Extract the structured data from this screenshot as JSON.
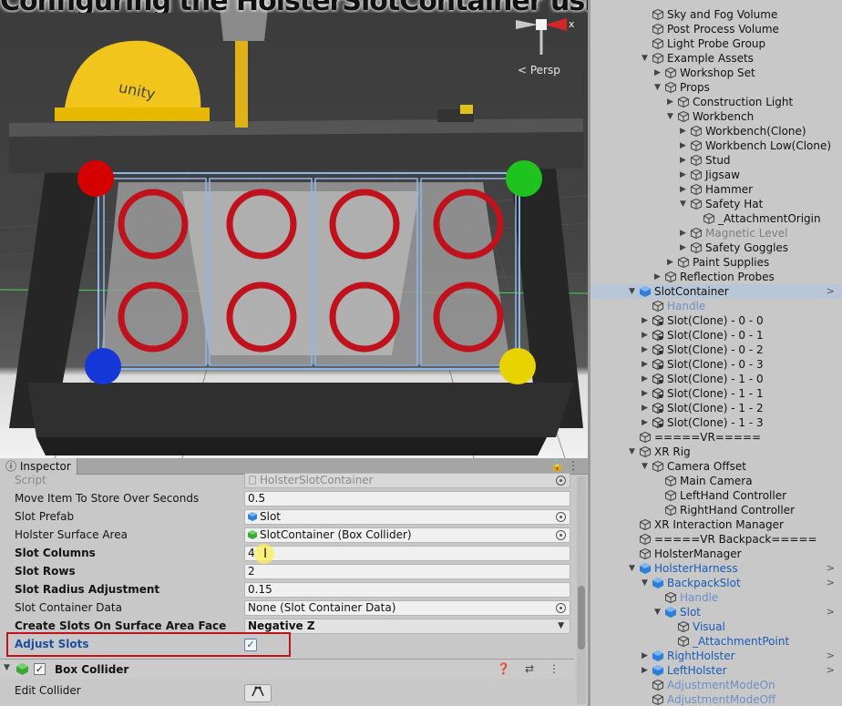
{
  "scene": {
    "overlay_title": "Configuring the HolsterSlotContainer using the Scene",
    "persp_label": "< Persp",
    "gizmo_axis_label": "x",
    "colors": {
      "slot_ring": "#c0121c",
      "corner_red": "#d40000",
      "corner_green": "#1ec31e",
      "corner_blue": "#1638d8",
      "corner_yellow": "#e8d200",
      "helmet": "#f2c51d"
    }
  },
  "hierarchy": {
    "items": [
      {
        "label": "Sky and Fog Volume",
        "depth": 1,
        "arrow": "",
        "icon": "cube-outline-icon"
      },
      {
        "label": "Post Process Volume",
        "depth": 1,
        "arrow": "",
        "icon": "cube-outline-icon"
      },
      {
        "label": "Light Probe Group",
        "depth": 1,
        "arrow": "",
        "icon": "cube-outline-icon"
      },
      {
        "label": "Example Assets",
        "depth": 1,
        "arrow": "▼",
        "icon": "cube-outline-icon"
      },
      {
        "label": "Workshop Set",
        "depth": 2,
        "arrow": "▶",
        "icon": "cube-outline-icon"
      },
      {
        "label": "Props",
        "depth": 2,
        "arrow": "▼",
        "icon": "cube-outline-icon"
      },
      {
        "label": "Construction Light",
        "depth": 3,
        "arrow": "▶",
        "icon": "cube-outline-icon"
      },
      {
        "label": "Workbench",
        "depth": 3,
        "arrow": "▼",
        "icon": "cube-outline-icon"
      },
      {
        "label": "Workbench(Clone)",
        "depth": 4,
        "arrow": "▶",
        "icon": "cube-outline-icon"
      },
      {
        "label": "Workbench Low(Clone)",
        "depth": 4,
        "arrow": "▶",
        "icon": "cube-outline-icon"
      },
      {
        "label": "Stud",
        "depth": 4,
        "arrow": "▶",
        "icon": "cube-outline-icon"
      },
      {
        "label": "Jigsaw",
        "depth": 4,
        "arrow": "▶",
        "icon": "cube-outline-icon"
      },
      {
        "label": "Hammer",
        "depth": 4,
        "arrow": "▶",
        "icon": "cube-outline-icon"
      },
      {
        "label": "Safety Hat",
        "depth": 4,
        "arrow": "▼",
        "icon": "cube-outline-icon"
      },
      {
        "label": "_AttachmentOrigin",
        "depth": 5,
        "arrow": "",
        "icon": "cube-outline-icon"
      },
      {
        "label": "Magnetic Level",
        "depth": 4,
        "arrow": "▶",
        "icon": "cube-outline-icon",
        "style": "dim"
      },
      {
        "label": "Safety Goggles",
        "depth": 4,
        "arrow": "▶",
        "icon": "cube-outline-icon"
      },
      {
        "label": "Paint Supplies",
        "depth": 3,
        "arrow": "▶",
        "icon": "cube-outline-icon"
      },
      {
        "label": "Reflection Probes",
        "depth": 2,
        "arrow": "▶",
        "icon": "cube-outline-icon"
      },
      {
        "label": "SlotContainer",
        "depth": 0,
        "arrow": "▼",
        "icon": "blue-cube-icon",
        "style": "sel",
        "more": ">"
      },
      {
        "label": "Handle",
        "depth": 1,
        "arrow": "",
        "icon": "cube-outline-icon",
        "style": "fadeblue"
      },
      {
        "label": "Slot(Clone) - 0 - 0",
        "depth": 1,
        "arrow": "▶",
        "icon": "prefab-cube-icon"
      },
      {
        "label": "Slot(Clone) - 0 - 1",
        "depth": 1,
        "arrow": "▶",
        "icon": "prefab-cube-icon"
      },
      {
        "label": "Slot(Clone) - 0 - 2",
        "depth": 1,
        "arrow": "▶",
        "icon": "prefab-cube-icon"
      },
      {
        "label": "Slot(Clone) - 0 - 3",
        "depth": 1,
        "arrow": "▶",
        "icon": "prefab-cube-icon"
      },
      {
        "label": "Slot(Clone) - 1 - 0",
        "depth": 1,
        "arrow": "▶",
        "icon": "prefab-cube-icon"
      },
      {
        "label": "Slot(Clone) - 1 - 1",
        "depth": 1,
        "arrow": "▶",
        "icon": "prefab-cube-icon"
      },
      {
        "label": "Slot(Clone) - 1 - 2",
        "depth": 1,
        "arrow": "▶",
        "icon": "prefab-cube-icon"
      },
      {
        "label": "Slot(Clone) - 1 - 3",
        "depth": 1,
        "arrow": "▶",
        "icon": "prefab-cube-icon"
      },
      {
        "label": "=====VR=====",
        "depth": 0,
        "arrow": "",
        "icon": "cube-outline-icon"
      },
      {
        "label": "XR Rig",
        "depth": 0,
        "arrow": "▼",
        "icon": "cube-outline-icon"
      },
      {
        "label": "Camera Offset",
        "depth": 1,
        "arrow": "▼",
        "icon": "cube-outline-icon"
      },
      {
        "label": "Main Camera",
        "depth": 2,
        "arrow": "",
        "icon": "cube-outline-icon"
      },
      {
        "label": "LeftHand Controller",
        "depth": 2,
        "arrow": "",
        "icon": "cube-outline-icon"
      },
      {
        "label": "RightHand Controller",
        "depth": 2,
        "arrow": "",
        "icon": "cube-outline-icon"
      },
      {
        "label": "XR Interaction Manager",
        "depth": 0,
        "arrow": "",
        "icon": "cube-outline-icon"
      },
      {
        "label": "=====VR Backpack=====",
        "depth": 0,
        "arrow": "",
        "icon": "cube-outline-icon"
      },
      {
        "label": "HolsterManager",
        "depth": 0,
        "arrow": "",
        "icon": "cube-outline-icon"
      },
      {
        "label": "HolsterHarness",
        "depth": 0,
        "arrow": "▼",
        "icon": "blue-cube-icon",
        "style": "blue",
        "more": ">"
      },
      {
        "label": "BackpackSlot",
        "depth": 1,
        "arrow": "▼",
        "icon": "blue-cube-icon",
        "style": "blue",
        "more": ">"
      },
      {
        "label": "Handle",
        "depth": 2,
        "arrow": "",
        "icon": "cube-outline-icon",
        "style": "fadeblue"
      },
      {
        "label": "Slot",
        "depth": 2,
        "arrow": "▼",
        "icon": "blue-cube-icon",
        "style": "blue",
        "more": ">"
      },
      {
        "label": "Visual",
        "depth": 3,
        "arrow": "",
        "icon": "cube-outline-icon",
        "style": "blue"
      },
      {
        "label": "_AttachmentPoint",
        "depth": 3,
        "arrow": "",
        "icon": "cube-outline-icon",
        "style": "blue"
      },
      {
        "label": "RightHolster",
        "depth": 1,
        "arrow": "▶",
        "icon": "blue-cube-icon",
        "style": "blue",
        "more": ">"
      },
      {
        "label": "LeftHolster",
        "depth": 1,
        "arrow": "▶",
        "icon": "blue-cube-icon",
        "style": "blue",
        "more": ">"
      },
      {
        "label": "AdjustmentModeOn",
        "depth": 1,
        "arrow": "",
        "icon": "cube-outline-icon",
        "style": "fadeblue"
      },
      {
        "label": "AdjustmentModeOff",
        "depth": 1,
        "arrow": "",
        "icon": "cube-outline-icon",
        "style": "fadeblue"
      }
    ]
  },
  "inspector": {
    "tab_label": "Inspector",
    "tab_tools": "🔒 ⋮",
    "rows": [
      {
        "label": "Script",
        "value": "HolsterSlotContainer",
        "label_style": "dim",
        "field_style": "dim",
        "icon": "script-icon",
        "target": true
      },
      {
        "label": "Move Item To Store Over Seconds",
        "value": "0.5"
      },
      {
        "label": "Slot Prefab",
        "value": "Slot",
        "icon": "blue-cube-icon",
        "target": true
      },
      {
        "label": "Holster Surface Area",
        "value": "SlotContainer (Box Collider)",
        "icon": "green-collider-icon",
        "target": true
      },
      {
        "label": "Slot Columns",
        "value": "4",
        "label_style": "bold"
      },
      {
        "label": "Slot Rows",
        "value": "2",
        "label_style": "bold"
      },
      {
        "label": "Slot Radius Adjustment",
        "value": "0.15",
        "label_style": "bold"
      },
      {
        "label": "Slot Container Data",
        "value": "None (Slot Container Data)",
        "target": true
      },
      {
        "label": "Create Slots On Surface Area Face",
        "value": "Negative Z",
        "label_style": "bold",
        "field_style": "dropdown"
      },
      {
        "label": "Adjust Slots",
        "value": "",
        "label_style": "blue",
        "checkbox": true
      }
    ],
    "component": {
      "title": "Box Collider",
      "tools": "❓ ⇄ ⋮"
    },
    "edit_collider_label": "Edit Collider",
    "edit_collider_icon": "edit-collider-icon"
  }
}
